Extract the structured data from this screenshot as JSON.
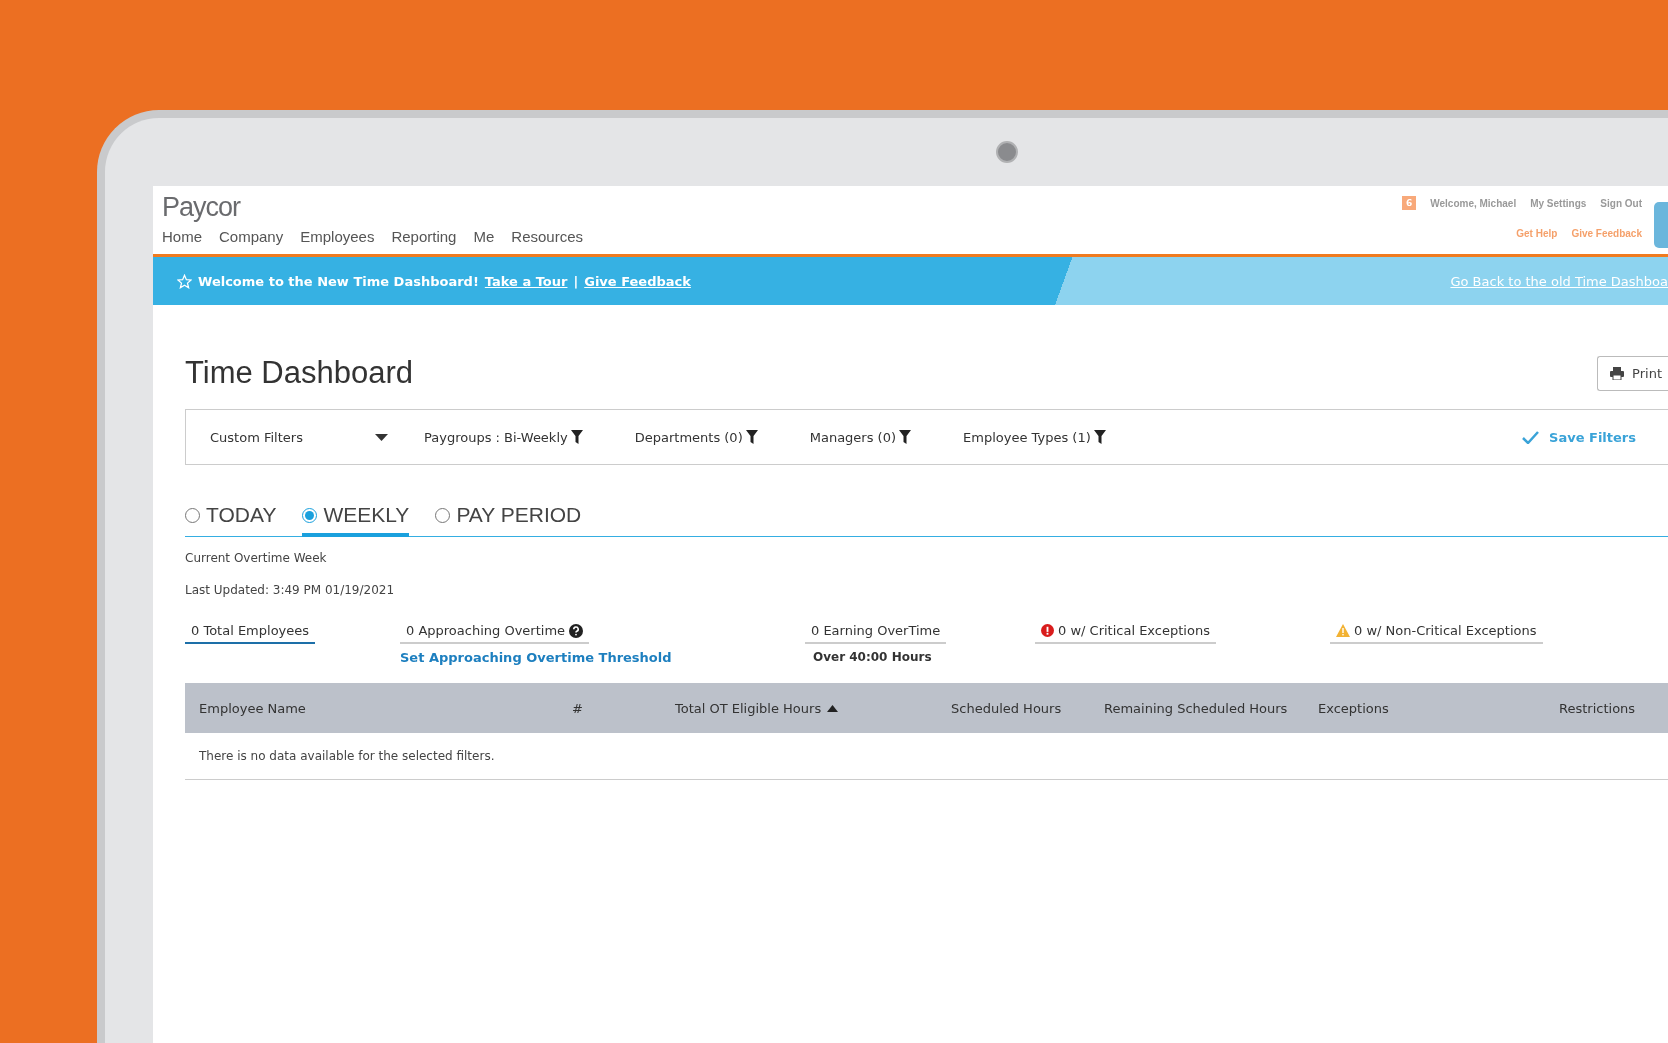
{
  "header": {
    "logo": "Paycor",
    "nav": [
      "Home",
      "Company",
      "Employees",
      "Reporting",
      "Me",
      "Resources"
    ],
    "badge": "6",
    "user_links": [
      "Welcome, Michael",
      "My Settings",
      "Sign Out"
    ],
    "help_links": [
      "Get Help",
      "Give Feedback"
    ]
  },
  "banner": {
    "message": "Welcome to the New Time Dashboard!",
    "links": [
      "Take a Tour",
      "Give Feedback"
    ],
    "separator": "|",
    "back_link": "Go Back to the old Time Dashboa"
  },
  "title": "Time Dashboard",
  "print_button": "Print",
  "filters": {
    "custom": "Custom Filters",
    "items": [
      "Paygroups : Bi-Weekly",
      "Departments (0)",
      "Managers (0)",
      "Employee Types (1)"
    ],
    "save": "Save Filters"
  },
  "tabs": [
    {
      "label": "TODAY",
      "selected": false
    },
    {
      "label": "WEEKLY",
      "selected": true
    },
    {
      "label": "PAY PERIOD",
      "selected": false
    }
  ],
  "period": "Current Overtime Week",
  "last_updated": "Last Updated: 3:49 PM 01/19/2021",
  "stats": [
    {
      "kind": "plain",
      "label": "0 Total Employees",
      "selected": true
    },
    {
      "kind": "help",
      "label": "0 Approaching Overtime",
      "selected": false,
      "link": "Set Approaching Overtime Threshold"
    },
    {
      "kind": "plain",
      "label": "0 Earning OverTime",
      "selected": false,
      "note": "Over 40:00 Hours"
    },
    {
      "kind": "critical",
      "label": "0 w/ Critical Exceptions",
      "selected": false
    },
    {
      "kind": "warning",
      "label": "0 w/ Non-Critical Exceptions",
      "selected": false
    }
  ],
  "table": {
    "columns": [
      {
        "label": "Employee Name",
        "sorted": false
      },
      {
        "label": "#",
        "sorted": false
      },
      {
        "label": "Total OT Eligible Hours",
        "sorted": true
      },
      {
        "label": "Scheduled Hours",
        "sorted": false
      },
      {
        "label": "Remaining Scheduled Hours",
        "sorted": false
      },
      {
        "label": "Exceptions",
        "sorted": false
      },
      {
        "label": "Restrictions",
        "sorted": false
      }
    ],
    "empty_message": "There is no data available for the selected filters."
  }
}
